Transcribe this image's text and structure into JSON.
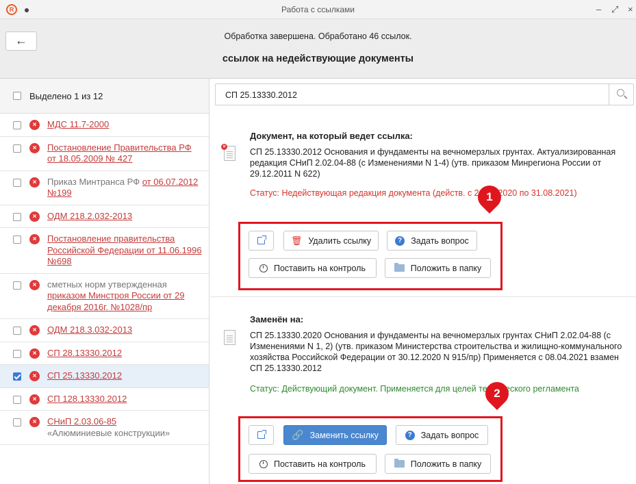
{
  "window": {
    "title": "Работа с ссылками",
    "minimize": "–",
    "maximize": "⤢",
    "close": "×"
  },
  "header": {
    "back_icon": "←",
    "status": "Обработка завершена. Обработано 46 ссылок.",
    "title": "ссылок на недействующие документы"
  },
  "left": {
    "selected_text": "Выделено 1 из 12",
    "items": [
      {
        "checked": false,
        "gray": "",
        "link": "МДС 11.7-2000"
      },
      {
        "checked": false,
        "gray": "",
        "link": "Постановление Правительства РФ от 18.05.2009 № 427"
      },
      {
        "checked": false,
        "gray": "Приказ Минтранса РФ ",
        "link": "от 06.07.2012 №199"
      },
      {
        "checked": false,
        "gray": "",
        "link": "ОДМ 218.2.032-2013"
      },
      {
        "checked": false,
        "gray": "",
        "link": "Постановление правительства Российской Федерации от 11.06.1996 №698"
      },
      {
        "checked": false,
        "gray": "сметных норм утвержденная ",
        "link": "приказом Минстроя России от 29 декабря 2016г. №1028/пр"
      },
      {
        "checked": false,
        "gray": "",
        "link": "ОДМ 218.3.032-2013"
      },
      {
        "checked": false,
        "gray": "",
        "link": "СП 28.13330.2012"
      },
      {
        "checked": true,
        "gray": "",
        "link": "СП 25.13330.2012"
      },
      {
        "checked": false,
        "gray": "",
        "link": "СП 128.13330.2012"
      },
      {
        "checked": false,
        "gray": "«Алюминиевые конструкции»",
        "link": "СНиП 2.03.06-85"
      }
    ]
  },
  "search": {
    "value": "СП 25.13330.2012"
  },
  "section1": {
    "title": "Документ, на который ведет ссылка:",
    "description": "СП 25.13330.2012 Основания и фундаменты на вечномерзлых грунтах. Актуализированная редакция СНиП 2.02.04-88 (с Изменениями N 1-4) (утв. приказом Минрегиона России от 29.12.2011 N 622)",
    "status": "Статус: Недействующая редакция документа (действ. с 26.05.2020 по 31.08.2021)",
    "buttons": {
      "delete": "Удалить ссылку",
      "ask": "Задать вопрос",
      "control": "Поставить на контроль",
      "folder": "Положить в папку"
    },
    "marker": "1"
  },
  "section2": {
    "title": "Заменён на:",
    "description": "СП 25.13330.2020 Основания и фундаменты на вечномерзлых грунтах СНиП 2.02.04-88 (с Изменениями N 1, 2) (утв. приказом Министерства строительства и жилищно-коммунального хозяйства Российской Федерации от 30.12.2020 N 915/пр) Применяется с 08.04.2021 взамен СП 25.13330.2012",
    "status": "Статус: Действующий документ. Применяется для целей технического регламента",
    "buttons": {
      "replace": "Заменить ссылку",
      "ask": "Задать вопрос",
      "control": "Поставить на контроль",
      "folder": "Положить в папку"
    },
    "marker": "2"
  },
  "colors": {
    "accent": "#4a87cf",
    "link_red": "#c43b3b",
    "status_red": "#d6332b",
    "status_green": "#2e8a2e",
    "annotation": "#e0161f"
  }
}
